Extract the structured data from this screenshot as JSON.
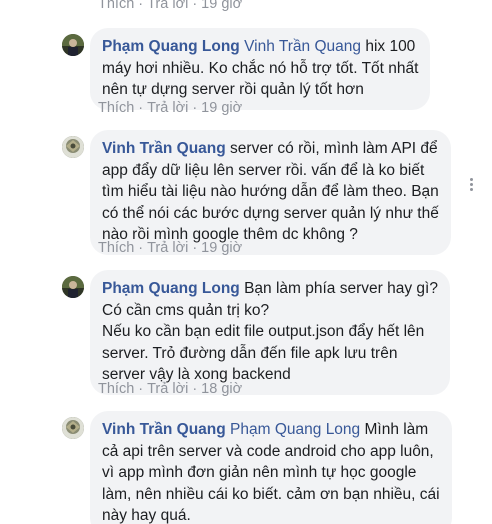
{
  "top_actions": {
    "like": "Thích",
    "sep": "·",
    "reply": "Trả lời",
    "time": "19 giờ"
  },
  "comments": [
    {
      "author": "Phạm Quang Long",
      "mention": "Vinh Trần Quang",
      "lines": [
        " hix 100",
        "máy hơi nhiều. Ko chắc nó hỗ trợ tốt. Tốt nhất",
        "nên tự dựng server rồi quản lý tốt hơn"
      ],
      "actions": {
        "like": "Thích",
        "sep": "·",
        "reply": "Trả lời",
        "time": "19 giờ"
      }
    },
    {
      "author": "Vinh Trần Quang",
      "mention": "",
      "lines": [
        " server có rồi, mình làm API để",
        "app đẩy dữ liệu lên server rồi. vấn để là ko biết",
        "tìm hiểu tài liệu nào hướng dẫn để làm theo. Bạn",
        "có thể nói các bước dựng server quản lý như thế",
        "nào rồi mình google thêm dc không ?"
      ],
      "actions": {
        "like": "Thích",
        "sep": "·",
        "reply": "Trả lời",
        "time": "19 giờ"
      }
    },
    {
      "author": "Phạm Quang Long",
      "mention": "",
      "lines": [
        " Bạn làm phía server hay gì?",
        "Có cần cms quản trị ko?",
        "Nếu ko cần bạn edit file output.json đẩy hết lên",
        "server. Trỏ đường dẫn đến file apk lưu trên",
        "server vậy là xong backend"
      ],
      "actions": {
        "like": "Thích",
        "sep": "·",
        "reply": "Trả lời",
        "time": "18 giờ"
      }
    },
    {
      "author": "Vinh Trần Quang",
      "mention": "Phạm Quang Long",
      "lines": [
        " Mình làm",
        "cả api trên server và code android cho app luôn,",
        "vì app mình đơn giản nên mình tự học google",
        "làm, nên nhiều cái ko biết. cảm ơn bạn nhiều, cái",
        "này hay quá."
      ]
    }
  ]
}
